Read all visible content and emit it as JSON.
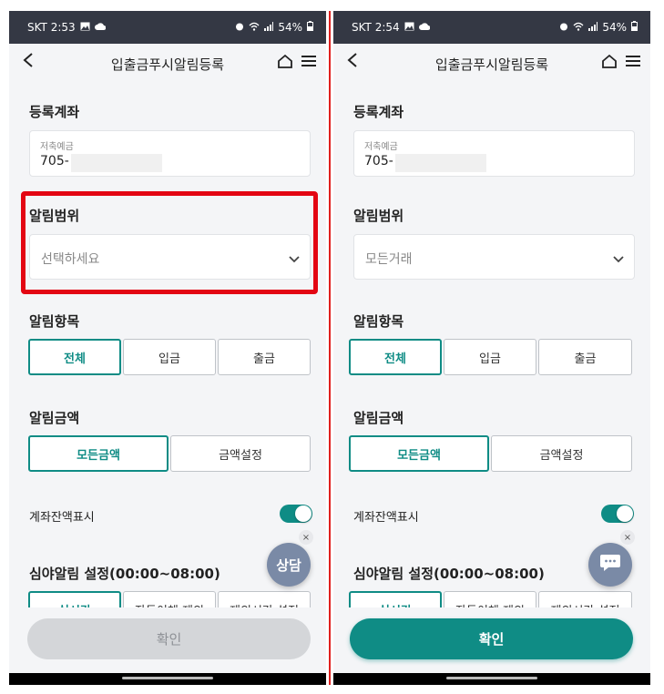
{
  "colors": {
    "accent": "#0f8c85",
    "highlight": "#e30613",
    "status_bar": "#343844",
    "fab": "#7a8aa6"
  },
  "left": {
    "status": {
      "carrier_time": "SKT 2:53",
      "battery": "54%"
    },
    "title": "입출금푸시알림등록",
    "account": {
      "section": "등록계좌",
      "type": "저축예금",
      "number": "705-"
    },
    "scope": {
      "section": "알림범위",
      "value": "선택하세요"
    },
    "items": {
      "section": "알림항목",
      "options": [
        "전체",
        "입금",
        "출금"
      ],
      "selected": "전체"
    },
    "amount": {
      "section": "알림금액",
      "options": [
        "모든금액",
        "금액설정"
      ],
      "selected": "모든금액"
    },
    "balance_toggle": {
      "label": "계좌잔액표시",
      "on": true
    },
    "night": {
      "section": "심야알림 설정(00:00~08:00)",
      "options": [
        "실시간",
        "자동이체 제외",
        "제외시간 설정"
      ],
      "selected": "실시간"
    },
    "fab_label": "상담",
    "fab_close": "×",
    "confirm": "확인"
  },
  "right": {
    "status": {
      "carrier_time": "SKT 2:54",
      "battery": "54%"
    },
    "title": "입출금푸시알림등록",
    "account": {
      "section": "등록계좌",
      "type": "저축예금",
      "number": "705-"
    },
    "scope": {
      "section": "알림범위",
      "value": "모든거래"
    },
    "items": {
      "section": "알림항목",
      "options": [
        "전체",
        "입금",
        "출금"
      ],
      "selected": "전체"
    },
    "amount": {
      "section": "알림금액",
      "options": [
        "모든금액",
        "금액설정"
      ],
      "selected": "모든금액"
    },
    "balance_toggle": {
      "label": "계좌잔액표시",
      "on": true
    },
    "night": {
      "section": "심야알림 설정(00:00~08:00)",
      "options": [
        "실시간",
        "자동이체 제외",
        "제외시간 설정"
      ],
      "selected": "실시간"
    },
    "fab_icon": "chat-bubble-icon",
    "fab_close": "×",
    "confirm": "확인"
  }
}
